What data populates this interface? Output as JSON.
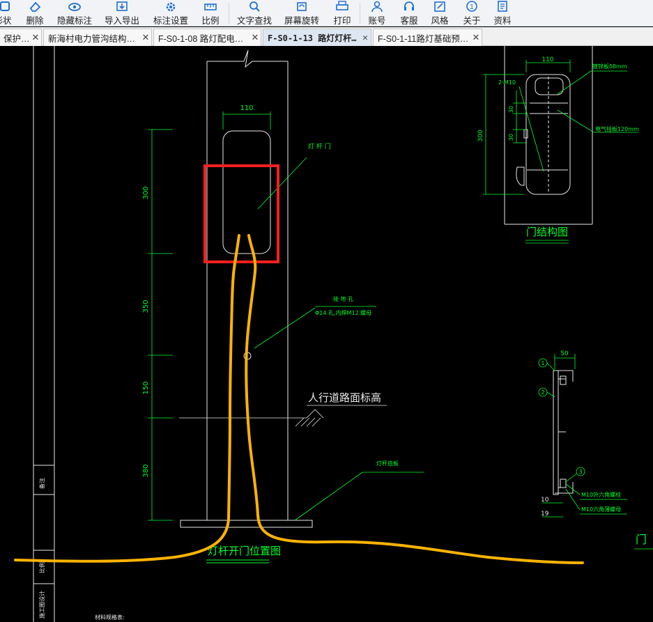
{
  "toolbar": {
    "buttons": [
      {
        "label": "形状",
        "icon": "shape-icon"
      },
      {
        "label": "删除",
        "icon": "eraser-icon"
      },
      {
        "label": "隐藏标注",
        "icon": "eye-icon"
      },
      {
        "label": "导入导出",
        "icon": "import-export-icon"
      },
      {
        "label": "标注设置",
        "icon": "settings-icon"
      },
      {
        "label": "比例",
        "icon": "ruler-icon"
      },
      {
        "label": "文字查找",
        "icon": "text-search-icon"
      },
      {
        "label": "屏幕旋转",
        "icon": "rotate-icon"
      },
      {
        "label": "打印",
        "icon": "printer-icon"
      },
      {
        "label": "账号",
        "icon": "user-icon"
      },
      {
        "label": "客服",
        "icon": "headset-icon"
      },
      {
        "label": "风格",
        "icon": "style-icon"
      },
      {
        "label": "关于",
        "icon": "info-icon"
      },
      {
        "label": "资料",
        "icon": "docs-icon"
      }
    ]
  },
  "tabs": [
    {
      "label": "保护…"
    },
    {
      "label": "新海村电力管沟结构…"
    },
    {
      "label": "F-S0-1-08 路灯配电…"
    },
    {
      "label": "F-S0-1-13 路灯灯杆…",
      "active": true
    },
    {
      "label": "F-S0-1-11路灯基础预…"
    }
  ],
  "drawing": {
    "dim_110_top": "110",
    "dim_300": "300",
    "dim_350": "350",
    "dim_150": "150",
    "dim_380": "380",
    "label_door": "灯 杆 门",
    "label_ground_hole": "接 地 孔",
    "label_ground_hole_spec": "Φ14 孔,内焊M12 螺母",
    "label_sidewalk": "人行道路面标高",
    "label_base_plate": "灯杆底板",
    "title_position": "灯杆开门位置图",
    "detail_dim_110": "110",
    "detail_dim_300": "300",
    "detail_m10": "2-M10",
    "detail_dim_30a": "30",
    "detail_dim_30b": "30",
    "detail_plate": "镀锌板δ8mm",
    "detail_board": "电气挂板120mm",
    "title_door_structure": "门结构图",
    "section_dim_50": "50",
    "section_n1": "1",
    "section_n2": "2",
    "section_n3": "3",
    "section_bolt": "M10外六角螺栓",
    "section_nut": "M10六角薄螺母",
    "section_dim_10": "10",
    "section_dim_19": "19",
    "bottom_note": "材料规格表:",
    "side_door_char": "门"
  },
  "colors": {
    "cad_green": "#00ff2a",
    "cad_white": "#e8e8e8",
    "highlight_red": "#ff2020",
    "marker_orange": "#ffb300"
  }
}
